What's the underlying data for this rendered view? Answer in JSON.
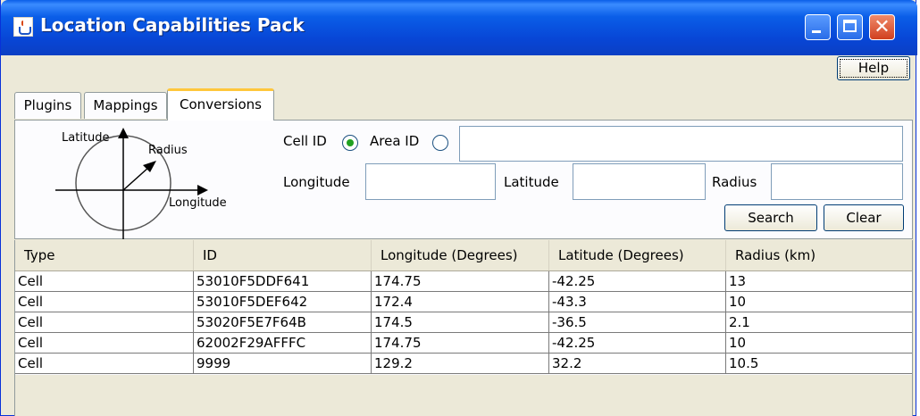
{
  "window": {
    "title": "Location Capabilities Pack"
  },
  "help_label": "Help",
  "tabs": [
    {
      "label": "Plugins"
    },
    {
      "label": "Mappings"
    },
    {
      "label": "Conversions"
    }
  ],
  "diagram": {
    "latitude": "Latitude",
    "radius": "Radius",
    "longitude": "Longitude"
  },
  "form": {
    "cell_id_label": "Cell ID",
    "area_id_label": "Area ID",
    "selected_id_type": "Cell ID",
    "id_value": "",
    "longitude_label": "Longitude",
    "longitude_value": "",
    "latitude_label": "Latitude",
    "latitude_value": "",
    "radius_label": "Radius",
    "radius_value": "",
    "search_label": "Search",
    "clear_label": "Clear"
  },
  "table": {
    "columns": [
      "Type",
      "ID",
      "Longitude (Degrees)",
      "Latitude (Degrees)",
      "Radius (km)"
    ],
    "rows": [
      [
        "Cell",
        "53010F5DDF641",
        "174.75",
        "-42.25",
        "13"
      ],
      [
        "Cell",
        "53010F5DEF642",
        "172.4",
        "-43.3",
        "10"
      ],
      [
        "Cell",
        "53020F5E7F64B",
        "174.5",
        "-36.5",
        "2.1"
      ],
      [
        "Cell",
        "62002F29AFFFC",
        "174.75",
        "-42.25",
        "10"
      ],
      [
        "Cell",
        "9999",
        "129.2",
        "32.2",
        "10.5"
      ]
    ]
  }
}
